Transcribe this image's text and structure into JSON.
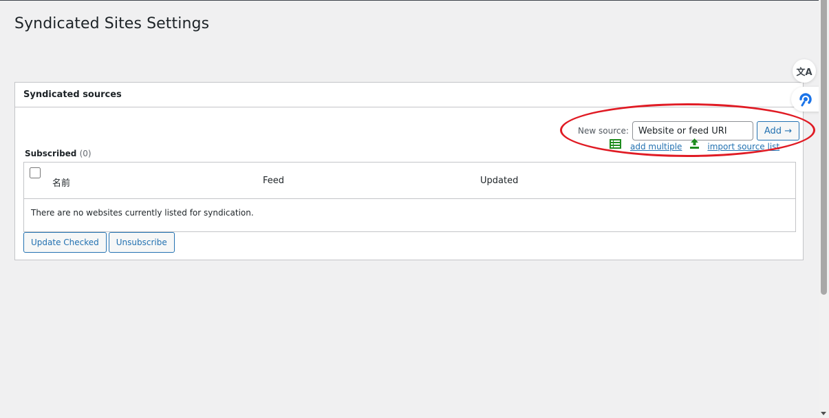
{
  "page": {
    "title": "Syndicated Sites Settings"
  },
  "panel": {
    "heading": "Syndicated sources",
    "new_source": {
      "label": "New source:",
      "placeholder": "Website or feed URI",
      "add_label": "Add →"
    },
    "links": {
      "add_multiple": "add multiple",
      "import_source_list": "import source list"
    },
    "subscribed": {
      "label": "Subscribed",
      "count": "(0)"
    },
    "table": {
      "columns": [
        "名前",
        "Feed",
        "Updated"
      ],
      "empty_message": "There are no websites currently listed for syndication."
    },
    "buttons": {
      "update_checked": "Update Checked",
      "unsubscribe": "Unsubscribe"
    }
  },
  "side": {
    "translate_glyph": "文A"
  },
  "icons": {
    "list": "list-icon",
    "upload": "upload-icon",
    "translate": "translate-icon",
    "assistant": "assistant-icon"
  },
  "colors": {
    "accent": "#2271b1",
    "icon_green": "#1e8c1e",
    "highlight": "#e01b24",
    "background": "#f0f0f1"
  }
}
